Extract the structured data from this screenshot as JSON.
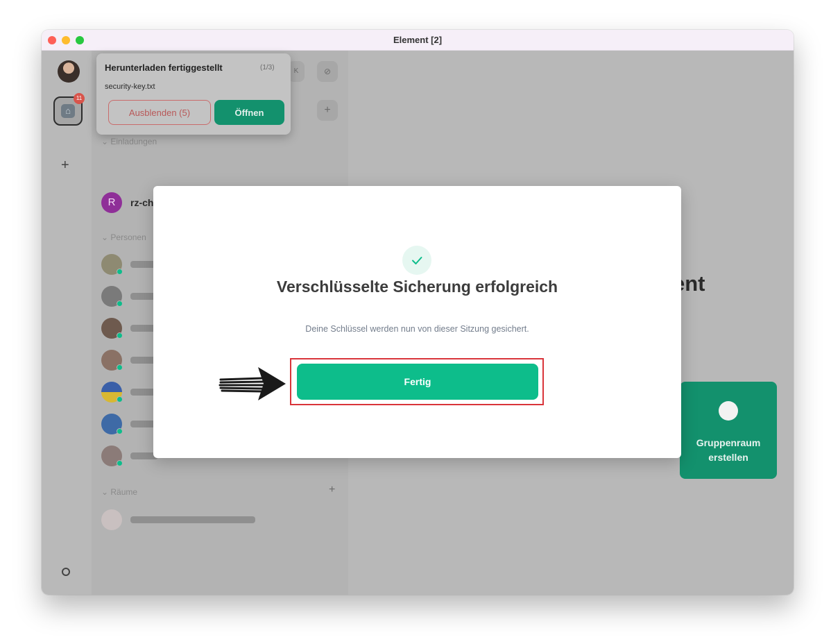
{
  "window": {
    "title": "Element [2]"
  },
  "spaces": {
    "home_badge": "11"
  },
  "left_panel": {
    "sections": [
      {
        "label": "Einladungen"
      },
      {
        "label": "Personen"
      },
      {
        "label": "Räume"
      }
    ],
    "invite_room": {
      "initial": "R",
      "name": "rz-chat"
    }
  },
  "main": {
    "heading_partial": "ent",
    "group_card_label": "Gruppenraum erstellen"
  },
  "toast": {
    "title": "Herunterladen fertiggestellt",
    "count": "(1/3)",
    "description": "security-key.txt",
    "dismiss_label": "Ausblenden (5)",
    "open_label": "Öffnen"
  },
  "dialog": {
    "title": "Verschlüsselte Sicherung erfolgreich",
    "description": "Deine Schlüssel werden nun von dieser Sitzung gesichert.",
    "done_label": "Fertig"
  },
  "colors": {
    "accent": "#0dbd8b",
    "highlight": "#d9343a",
    "badge": "#d8544b"
  }
}
